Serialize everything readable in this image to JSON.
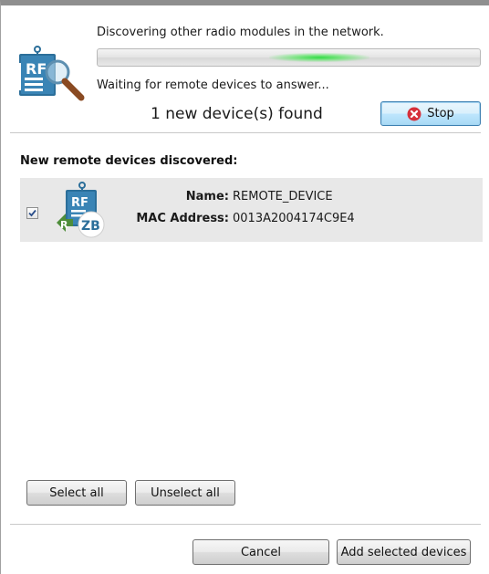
{
  "header": {
    "discover_text": "Discovering other radio modules in the network.",
    "waiting_text": "Waiting for remote devices to answer...",
    "found_text": "1 new device(s) found",
    "stop_label": "Stop",
    "progress_position": 0.58,
    "progress_glow_color": "#28dc3c",
    "icon": "radio-search-icon"
  },
  "devices": {
    "section_title": "New remote devices discovered:",
    "items": [
      {
        "checked": true,
        "icon": "zigbee-device-icon",
        "name_label": "Name:",
        "name_value": "REMOTE_DEVICE",
        "mac_label": "MAC Address:",
        "mac_value": "0013A2004174C9E4"
      }
    ]
  },
  "selection": {
    "select_all_label": "Select all",
    "unselect_all_label": "Unselect all"
  },
  "footer": {
    "cancel_label": "Cancel",
    "add_label": "Add selected devices"
  },
  "colors": {
    "stop_icon": "#d6303a",
    "device_row_bg": "#e8e8e8",
    "icon_blue": "#2c6f9a",
    "icon_green": "#4e8d3a"
  }
}
